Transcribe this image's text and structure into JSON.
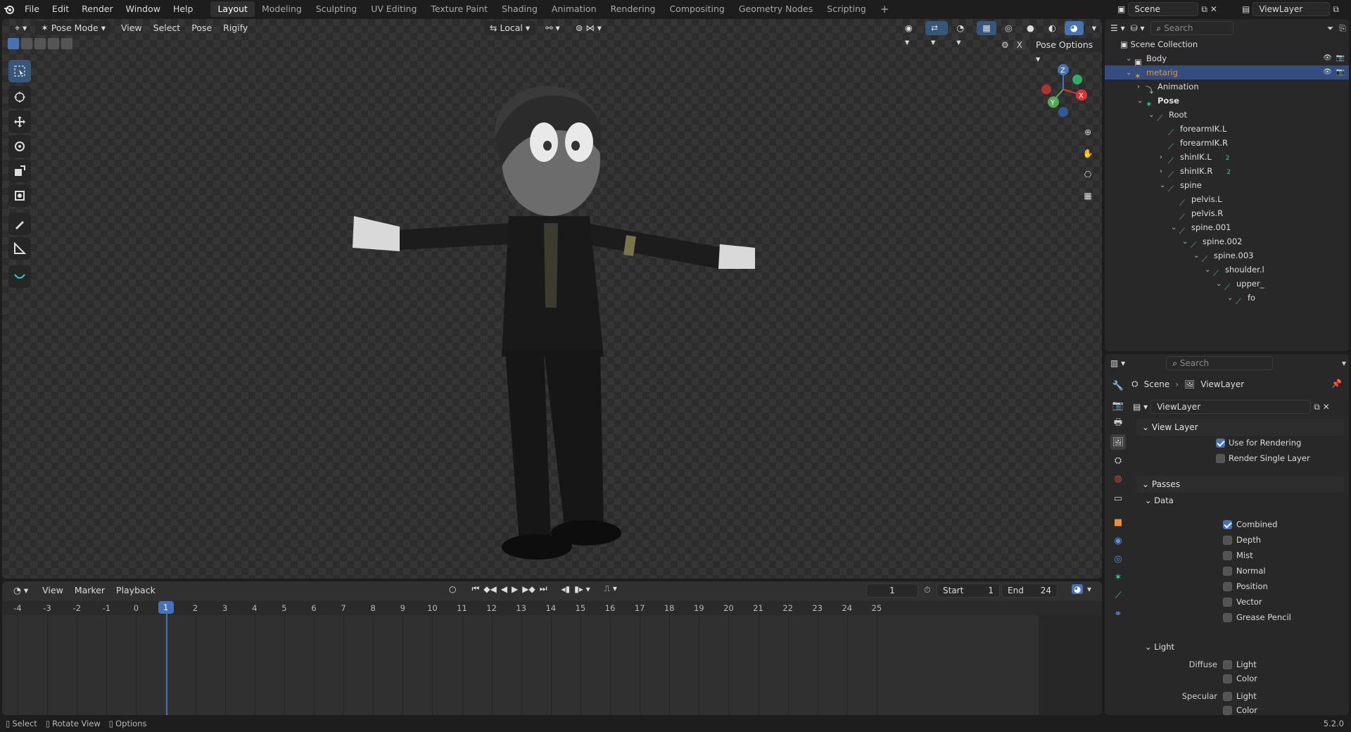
{
  "topbar": {
    "menus": [
      "File",
      "Edit",
      "Render",
      "Window",
      "Help"
    ],
    "workspaces": [
      "Layout",
      "Modeling",
      "Sculpting",
      "UV Editing",
      "Texture Paint",
      "Shading",
      "Animation",
      "Rendering",
      "Compositing",
      "Geometry Nodes",
      "Scripting"
    ],
    "active_workspace": "Layout",
    "add_symbol": "+",
    "scene": "Scene",
    "view_layer": "ViewLayer"
  },
  "viewport": {
    "mode": "Pose Mode",
    "menus": [
      "View",
      "Select",
      "Pose",
      "Rigify"
    ],
    "transform_orientation": "Local",
    "pose_options": "Pose Options",
    "x_mirror": "X"
  },
  "timeline": {
    "menus": [
      "View",
      "Marker",
      "Playback"
    ],
    "current_frame": "1",
    "start_label": "Start",
    "start": "1",
    "end_label": "End",
    "end": "24",
    "ruler": [
      "-4",
      "-3",
      "-2",
      "-1",
      "0",
      "1",
      "2",
      "3",
      "4",
      "5",
      "6",
      "7",
      "8",
      "9",
      "10",
      "11",
      "12",
      "13",
      "14",
      "15",
      "16",
      "17",
      "18",
      "19",
      "20",
      "21",
      "22",
      "23",
      "24",
      "25"
    ]
  },
  "outliner": {
    "search_placeholder": "Search",
    "scene_collection": "Scene Collection",
    "rows": [
      {
        "label": "Body"
      },
      {
        "label": "metarig"
      },
      {
        "label": "Animation"
      },
      {
        "label": "Pose"
      },
      {
        "label": "Root"
      },
      {
        "label": "forearmIK.L"
      },
      {
        "label": "forearmIK.R"
      },
      {
        "label": "shinIK.L",
        "badge": "2"
      },
      {
        "label": "shinIK.R",
        "badge": "2"
      },
      {
        "label": "spine"
      },
      {
        "label": "pelvis.L"
      },
      {
        "label": "pelvis.R"
      },
      {
        "label": "spine.001"
      },
      {
        "label": "spine.002"
      },
      {
        "label": "spine.003"
      },
      {
        "label": "shoulder.l"
      },
      {
        "label": "upper_"
      },
      {
        "label": "fo"
      }
    ]
  },
  "properties": {
    "search_placeholder": "Search",
    "breadcrumb_scene": "Scene",
    "breadcrumb_layer": "ViewLayer",
    "view_layer_name": "ViewLayer",
    "panel_view_layer": "View Layer",
    "use_for_rendering": "Use for Rendering",
    "render_single_layer": "Render Single Layer",
    "panel_passes": "Passes",
    "sub_data": "Data",
    "data_passes": [
      {
        "label": "Combined",
        "checked": true
      },
      {
        "label": "Depth",
        "checked": false
      },
      {
        "label": "Mist",
        "checked": false
      },
      {
        "label": "Normal",
        "checked": false
      },
      {
        "label": "Position",
        "checked": false
      },
      {
        "label": "Vector",
        "checked": false
      },
      {
        "label": "Grease Pencil",
        "checked": false
      }
    ],
    "sub_light": "Light",
    "diffuse_label": "Diffuse",
    "specular_label": "Specular",
    "light_label": "Light",
    "color_label": "Color"
  },
  "statusbar": {
    "select": "Select",
    "rotate": "Rotate View",
    "options": "Options",
    "version": "5.2.0"
  },
  "colors": {
    "accent": "#4772b3",
    "bone": "#39c6a5",
    "selected_row": "#334d80",
    "object_orange": "#e6943d"
  }
}
